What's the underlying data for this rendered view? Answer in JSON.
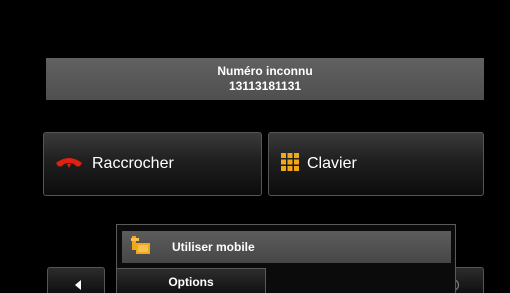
{
  "caller": {
    "name": "Numéro inconnu",
    "number": "13113181131"
  },
  "actions": {
    "hangup_label": "Raccrocher",
    "keypad_label": "Clavier"
  },
  "popup": {
    "item_label": "Utiliser mobile",
    "tab_label": "Options"
  },
  "colors": {
    "background": "#000000",
    "banner": "#575757",
    "hangup_icon": "#e02010",
    "keypad_icon": "#f0a818"
  },
  "icons": {
    "hangup": "phone-hangup-icon",
    "keypad": "keypad-grid-icon",
    "device": "mobile-device-icon",
    "prev": "arrow-left-icon",
    "next": "arrow-right-icon"
  }
}
